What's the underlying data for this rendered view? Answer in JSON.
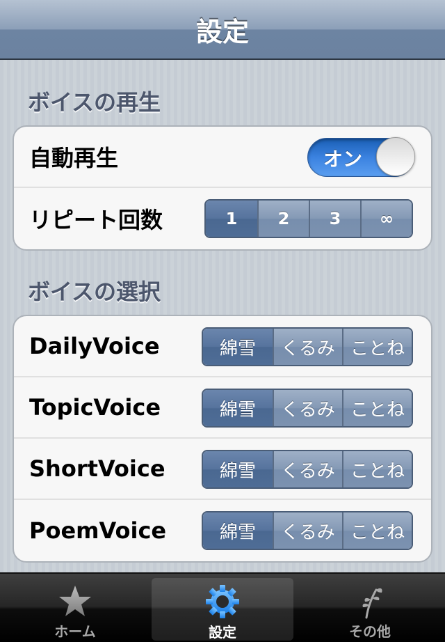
{
  "navbar": {
    "title": "設定"
  },
  "playback_section": {
    "header": "ボイスの再生",
    "autoplay": {
      "label": "自動再生",
      "toggle_text": "オン",
      "value": true
    },
    "repeat": {
      "label": "リピート回数",
      "options": [
        "1",
        "2",
        "3",
        "∞"
      ],
      "selected": "1"
    }
  },
  "voice_section": {
    "header": "ボイスの選択",
    "rows": [
      {
        "label": "DailyVoice",
        "options": [
          "綿雪",
          "くるみ",
          "ことね"
        ],
        "selected": "綿雪"
      },
      {
        "label": "TopicVoice",
        "options": [
          "綿雪",
          "くるみ",
          "ことね"
        ],
        "selected": "綿雪"
      },
      {
        "label": "ShortVoice",
        "options": [
          "綿雪",
          "くるみ",
          "ことね"
        ],
        "selected": "綿雪"
      },
      {
        "label": "PoemVoice",
        "options": [
          "綿雪",
          "くるみ",
          "ことね"
        ],
        "selected": "綿雪"
      }
    ]
  },
  "tabbar": {
    "tabs": [
      {
        "label": "ホーム",
        "icon": "star-icon",
        "active": false
      },
      {
        "label": "設定",
        "icon": "gear-icon",
        "active": true
      },
      {
        "label": "その他",
        "icon": "sprout-icon",
        "active": false
      }
    ]
  },
  "colors": {
    "accent_blue": "#3b82e0",
    "segment_selected": "#4f6d96",
    "segment_normal": "#8499b5",
    "gear_blue": "#3aa0ff"
  }
}
